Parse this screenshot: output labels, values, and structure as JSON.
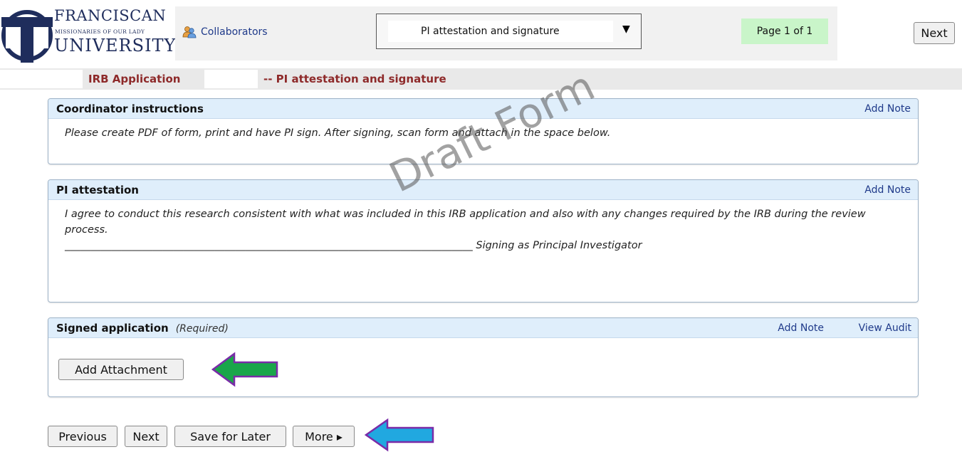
{
  "logo": {
    "line1": "FRANCISCAN",
    "line2": "MISSIONARIES OF OUR LADY",
    "line3": "UNIVERSITY",
    "colors": {
      "navy": "#1f2d5c"
    }
  },
  "header": {
    "collaborators_label": "Collaborators",
    "collaborators_icon": "people-icon",
    "page_select_value": "PI attestation and signature",
    "page_indicator": "Page 1 of 1",
    "next_label": "Next"
  },
  "title_bar": {
    "application": "IRB Application",
    "page": "-- PI attestation and signature"
  },
  "watermark": "Draft Form",
  "sections": {
    "coordinator": {
      "title": "Coordinator instructions",
      "add_note": "Add Note",
      "text": "Please create PDF of form, print and have PI sign.  After signing, scan form and attach in the space below."
    },
    "pi_attestation": {
      "title": "PI attestation",
      "add_note": "Add Note",
      "text": "I agree to conduct this research consistent with what was included in this IRB application and also with any changes required by the IRB during the review process.",
      "signature_line": "_______________________________________________________________________________ Signing as Principal Investigator"
    },
    "signed_application": {
      "title": "Signed application",
      "required": "(Required)",
      "add_note": "Add Note",
      "view_audit": "View Audit",
      "add_attachment": "Add Attachment"
    }
  },
  "footer": {
    "previous": "Previous",
    "next": "Next",
    "save_for_later": "Save for Later",
    "more": "More ▸"
  },
  "colors": {
    "accent_title": "#8e2a2a",
    "link": "#1f3a8a",
    "section_header": "#dfeefb",
    "page_badge": "#c9f5c9",
    "arrow_green": "#1aa64a",
    "arrow_blue": "#21a8e0",
    "arrow_outline": "#7a2ba8"
  }
}
